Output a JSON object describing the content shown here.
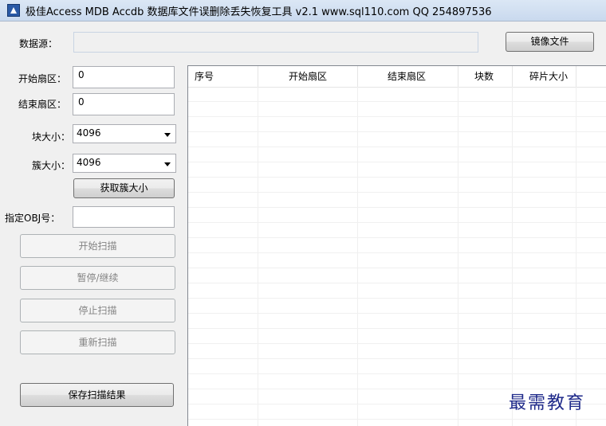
{
  "window": {
    "title": "极佳Access MDB Accdb 数据库文件误删除丢失恢复工具  v2.1  www.sql110.com  QQ 254897536"
  },
  "datasource": {
    "label": "数据源：",
    "value": "",
    "image_button": "镜像文件"
  },
  "params": {
    "start_sector_label": "开始扇区：",
    "start_sector_value": "0",
    "end_sector_label": "结束扇区：",
    "end_sector_value": "0",
    "block_size_label": "块大小：",
    "block_size_value": "4096",
    "cluster_size_label": "簇大小：",
    "cluster_size_value": "4096",
    "get_cluster_button": "获取簇大小",
    "obj_label": "指定OBJ号：",
    "obj_value": ""
  },
  "actions": {
    "start_scan": "开始扫描",
    "pause_resume": "暂停/继续",
    "stop_scan": "停止扫描",
    "rescan": "重新扫描",
    "save_results": "保存扫描结果"
  },
  "table": {
    "columns": [
      "序号",
      "开始扇区",
      "结束扇区",
      "块数",
      "碎片大小"
    ],
    "rows": []
  },
  "watermark": "最需教育"
}
